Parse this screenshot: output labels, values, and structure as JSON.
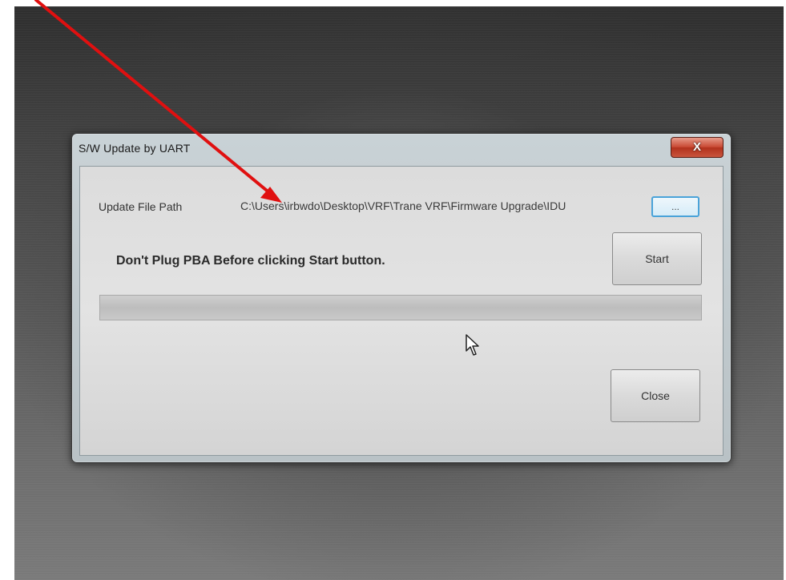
{
  "window": {
    "title": "S/W Update by UART",
    "close_glyph": "X"
  },
  "form": {
    "path_label": "Update File Path",
    "path_value": "C:\\Users\\irbwdo\\Desktop\\VRF\\Trane VRF\\Firmware Upgrade\\IDU",
    "browse_label": "...",
    "warning_text": "Don't Plug PBA Before clicking Start button.",
    "start_label": "Start",
    "close_label": "Close",
    "progress_fraction": 0
  },
  "annotation": {
    "arrow_color": "#e01010"
  },
  "icons": [
    "close-icon",
    "mouse-cursor-icon",
    "annotation-arrow-icon"
  ]
}
